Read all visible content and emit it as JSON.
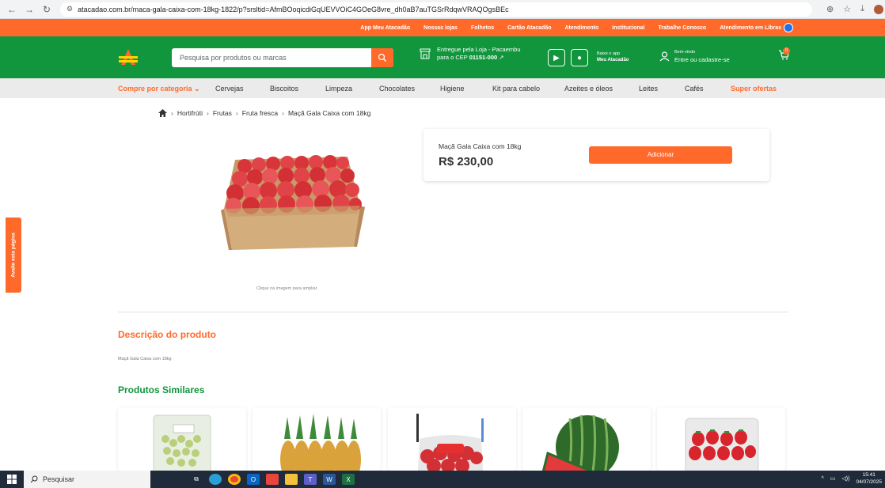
{
  "browser": {
    "url": "atacadao.com.br/maca-gala-caixa-com-18kg-1822/p?srsltid=AfmBOoqicdiGqUEVVOiC4GOeG8vre_dh0aB7auTGSrRdqwVRAQOgsBEc"
  },
  "topbar": {
    "links": [
      "App Meu Atacadão",
      "Nossas lojas",
      "Folhetos",
      "Cartão Atacadão",
      "Atendimento",
      "Institucional",
      "Trabalhe Conosco",
      "Atendimento em Libras"
    ]
  },
  "header": {
    "search_placeholder": "Pesquisa por produtos ou marcas",
    "delivery_line1": "Entregue pela Loja - Pacaembu",
    "delivery_prefix": "para o CEP",
    "delivery_cep": "01151-000",
    "app_line1": "Baixe o app",
    "app_line2": "Meu Atacadão",
    "login_line1": "Bem-vindo",
    "login_line2": "Entre ou cadastre-se",
    "cart_count": "0"
  },
  "categories": {
    "compre_label": "Compre por categoria",
    "items": [
      "Cervejas",
      "Biscoitos",
      "Limpeza",
      "Chocolates",
      "Higiene",
      "Kit para cabelo",
      "Azeites e óleos",
      "Leites",
      "Cafés"
    ],
    "super_label": "Super ofertas"
  },
  "breadcrumb": {
    "items": [
      "Hortifrúti",
      "Frutas",
      "Fruta fresca",
      "Maçã Gala Caixa com 18kg"
    ]
  },
  "product": {
    "name": "Maçã Gala Caixa com 18kg",
    "price": "R$ 230,00",
    "add_label": "Adicionar",
    "zoom_hint": "Clique na imagem para ampliar."
  },
  "side_tab": "Avalie esta página",
  "description": {
    "title": "Descrição do produto",
    "text": "Maçã Gala Caixa com 18kg"
  },
  "similar": {
    "title": "Produtos Similares"
  },
  "taskbar": {
    "search_label": "Pesquisar",
    "time": "15:41",
    "date": "04/07/2025"
  }
}
